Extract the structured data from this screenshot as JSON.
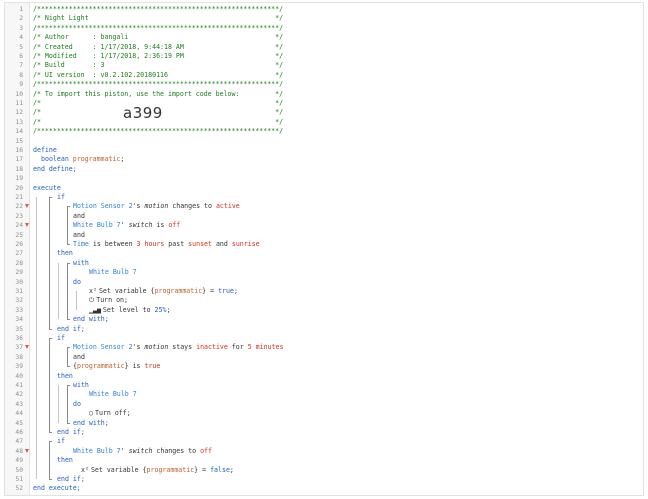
{
  "editor": {
    "import_code": "a399",
    "lines": [
      {
        "n": "1",
        "indent": 0,
        "parts": [
          {
            "t": "/*************************************************************/",
            "c": "c"
          }
        ]
      },
      {
        "n": "2",
        "indent": 0,
        "parts": [
          {
            "t": "/* Night Light                                               */",
            "c": "c"
          }
        ]
      },
      {
        "n": "3",
        "indent": 0,
        "parts": [
          {
            "t": "/*************************************************************/",
            "c": "c"
          }
        ]
      },
      {
        "n": "4",
        "indent": 0,
        "parts": [
          {
            "t": "/* Author      : bangali                                     */",
            "c": "c"
          }
        ]
      },
      {
        "n": "5",
        "indent": 0,
        "parts": [
          {
            "t": "/* Created     : 1/17/2018, 9:44:18 AM                       */",
            "c": "c"
          }
        ]
      },
      {
        "n": "6",
        "indent": 0,
        "parts": [
          {
            "t": "/* Modified    : 1/17/2018, 2:36:19 PM                       */",
            "c": "c"
          }
        ]
      },
      {
        "n": "7",
        "indent": 0,
        "parts": [
          {
            "t": "/* Build       : 3                                           */",
            "c": "c"
          }
        ]
      },
      {
        "n": "8",
        "indent": 0,
        "parts": [
          {
            "t": "/* UI version  : v0.2.102.20180116                           */",
            "c": "c"
          }
        ]
      },
      {
        "n": "9",
        "indent": 0,
        "parts": [
          {
            "t": "/*************************************************************/",
            "c": "c"
          }
        ]
      },
      {
        "n": "10",
        "indent": 0,
        "parts": [
          {
            "t": "/* To import this piston, use the import code below:         */",
            "c": "c"
          }
        ]
      },
      {
        "n": "11",
        "indent": 0,
        "parts": [
          {
            "t": "/*                                                           */",
            "c": "c"
          }
        ]
      },
      {
        "n": "12",
        "indent": 0,
        "parts": [
          {
            "t": "/*                                                           */",
            "c": "c"
          }
        ]
      },
      {
        "n": "13",
        "indent": 0,
        "parts": [
          {
            "t": "/*                                                           */",
            "c": "c"
          }
        ]
      },
      {
        "n": "14",
        "indent": 0,
        "parts": [
          {
            "t": "/*************************************************************/",
            "c": "c"
          }
        ]
      },
      {
        "n": "15",
        "indent": 0,
        "parts": []
      },
      {
        "n": "16",
        "indent": 0,
        "parts": [
          {
            "t": "define",
            "c": "kw"
          }
        ]
      },
      {
        "n": "17",
        "indent": 1,
        "parts": [
          {
            "t": "boolean ",
            "c": "kw"
          },
          {
            "t": "programmatic",
            "c": "var"
          },
          {
            "t": ";",
            "c": ""
          }
        ]
      },
      {
        "n": "18",
        "indent": 0,
        "parts": [
          {
            "t": "end define;",
            "c": "kw"
          }
        ]
      },
      {
        "n": "19",
        "indent": 0,
        "parts": []
      },
      {
        "n": "20",
        "indent": 0,
        "parts": [
          {
            "t": "execute",
            "c": "kw"
          }
        ]
      },
      {
        "n": "21",
        "indent": 3,
        "parts": [
          {
            "t": "if",
            "c": "kw"
          }
        ]
      },
      {
        "n": "22",
        "indent": 5,
        "arrow": true,
        "parts": [
          {
            "t": "Motion Sensor 2",
            "c": "dev"
          },
          {
            "t": "'s ",
            "c": ""
          },
          {
            "t": "motion",
            "c": "it"
          },
          {
            "t": " changes to ",
            "c": ""
          },
          {
            "t": "active",
            "c": "rd"
          }
        ]
      },
      {
        "n": "23",
        "indent": 5,
        "parts": [
          {
            "t": "and",
            "c": ""
          }
        ]
      },
      {
        "n": "24",
        "indent": 5,
        "arrow": true,
        "parts": [
          {
            "t": "White Bulb 7",
            "c": "dev"
          },
          {
            "t": "' ",
            "c": ""
          },
          {
            "t": "switch",
            "c": "it"
          },
          {
            "t": " is ",
            "c": ""
          },
          {
            "t": "off",
            "c": "rd"
          }
        ]
      },
      {
        "n": "25",
        "indent": 5,
        "parts": [
          {
            "t": "and",
            "c": ""
          }
        ]
      },
      {
        "n": "26",
        "indent": 5,
        "parts": [
          {
            "t": "Time",
            "c": "dev"
          },
          {
            "t": " is between ",
            "c": ""
          },
          {
            "t": "3 hours",
            "c": "rd"
          },
          {
            "t": " past ",
            "c": ""
          },
          {
            "t": "sunset",
            "c": "rd"
          },
          {
            "t": " and ",
            "c": ""
          },
          {
            "t": "sunrise",
            "c": "rd"
          }
        ]
      },
      {
        "n": "27",
        "indent": 3,
        "parts": [
          {
            "t": "then",
            "c": "kw"
          }
        ]
      },
      {
        "n": "28",
        "indent": 5,
        "parts": [
          {
            "t": "with",
            "c": "kw"
          }
        ]
      },
      {
        "n": "29",
        "indent": 7,
        "parts": [
          {
            "t": "White Bulb 7",
            "c": "dev"
          }
        ]
      },
      {
        "n": "30",
        "indent": 5,
        "parts": [
          {
            "t": "do",
            "c": "kw"
          }
        ]
      },
      {
        "n": "31",
        "indent": 7,
        "icon": "x²",
        "parts": [
          {
            "t": "Set variable {",
            "c": ""
          },
          {
            "t": "programmatic",
            "c": "var"
          },
          {
            "t": "} = ",
            "c": ""
          },
          {
            "t": "true",
            "c": "kw"
          },
          {
            "t": ";",
            "c": ""
          }
        ]
      },
      {
        "n": "32",
        "indent": 7,
        "icon": "⏻",
        "parts": [
          {
            "t": "Turn on;",
            "c": ""
          }
        ]
      },
      {
        "n": "33",
        "indent": 7,
        "icon": "▁▃▅",
        "parts": [
          {
            "t": "Set level to ",
            "c": ""
          },
          {
            "t": "25%",
            "c": "kw"
          },
          {
            "t": ";",
            "c": ""
          }
        ]
      },
      {
        "n": "34",
        "indent": 5,
        "parts": [
          {
            "t": "end with;",
            "c": "kw"
          }
        ]
      },
      {
        "n": "35",
        "indent": 3,
        "parts": [
          {
            "t": "end if;",
            "c": "kw"
          }
        ]
      },
      {
        "n": "36",
        "indent": 3,
        "parts": [
          {
            "t": "if",
            "c": "kw"
          }
        ]
      },
      {
        "n": "37",
        "indent": 5,
        "arrow": true,
        "parts": [
          {
            "t": "Motion Sensor 2",
            "c": "dev"
          },
          {
            "t": "'s ",
            "c": ""
          },
          {
            "t": "motion",
            "c": "it"
          },
          {
            "t": " stays ",
            "c": ""
          },
          {
            "t": "inactive",
            "c": "rd"
          },
          {
            "t": " for ",
            "c": ""
          },
          {
            "t": "5 minutes",
            "c": "rd"
          }
        ]
      },
      {
        "n": "38",
        "indent": 5,
        "parts": [
          {
            "t": "and",
            "c": ""
          }
        ]
      },
      {
        "n": "39",
        "indent": 5,
        "parts": [
          {
            "t": "{",
            "c": ""
          },
          {
            "t": "programmatic",
            "c": "var"
          },
          {
            "t": "} is ",
            "c": ""
          },
          {
            "t": "true",
            "c": "rd"
          }
        ]
      },
      {
        "n": "40",
        "indent": 3,
        "parts": [
          {
            "t": "then",
            "c": "kw"
          }
        ]
      },
      {
        "n": "41",
        "indent": 5,
        "parts": [
          {
            "t": "with",
            "c": "kw"
          }
        ]
      },
      {
        "n": "42",
        "indent": 7,
        "parts": [
          {
            "t": "White Bulb 7",
            "c": "dev"
          }
        ]
      },
      {
        "n": "43",
        "indent": 5,
        "parts": [
          {
            "t": "do",
            "c": "kw"
          }
        ]
      },
      {
        "n": "44",
        "indent": 7,
        "icon": "◯",
        "parts": [
          {
            "t": "Turn off;",
            "c": ""
          }
        ]
      },
      {
        "n": "45",
        "indent": 5,
        "parts": [
          {
            "t": "end with;",
            "c": "kw"
          }
        ]
      },
      {
        "n": "46",
        "indent": 3,
        "parts": [
          {
            "t": "end if;",
            "c": "kw"
          }
        ]
      },
      {
        "n": "47",
        "indent": 3,
        "parts": [
          {
            "t": "if",
            "c": "kw"
          }
        ]
      },
      {
        "n": "48",
        "indent": 5,
        "arrow": true,
        "parts": [
          {
            "t": "White Bulb 7",
            "c": "dev"
          },
          {
            "t": "' ",
            "c": ""
          },
          {
            "t": "switch",
            "c": "it"
          },
          {
            "t": " changes to ",
            "c": ""
          },
          {
            "t": "off",
            "c": "rd"
          }
        ]
      },
      {
        "n": "49",
        "indent": 3,
        "parts": [
          {
            "t": "then",
            "c": "kw"
          }
        ]
      },
      {
        "n": "50",
        "indent": 6,
        "icon": "x²",
        "parts": [
          {
            "t": "Set variable {",
            "c": ""
          },
          {
            "t": "programmatic",
            "c": "var"
          },
          {
            "t": "} = ",
            "c": ""
          },
          {
            "t": "false",
            "c": "kw"
          },
          {
            "t": ";",
            "c": ""
          }
        ]
      },
      {
        "n": "51",
        "indent": 3,
        "parts": [
          {
            "t": "end if;",
            "c": "kw"
          }
        ]
      },
      {
        "n": "52",
        "indent": 0,
        "parts": [
          {
            "t": "end execute;",
            "c": "kw"
          }
        ]
      }
    ]
  }
}
